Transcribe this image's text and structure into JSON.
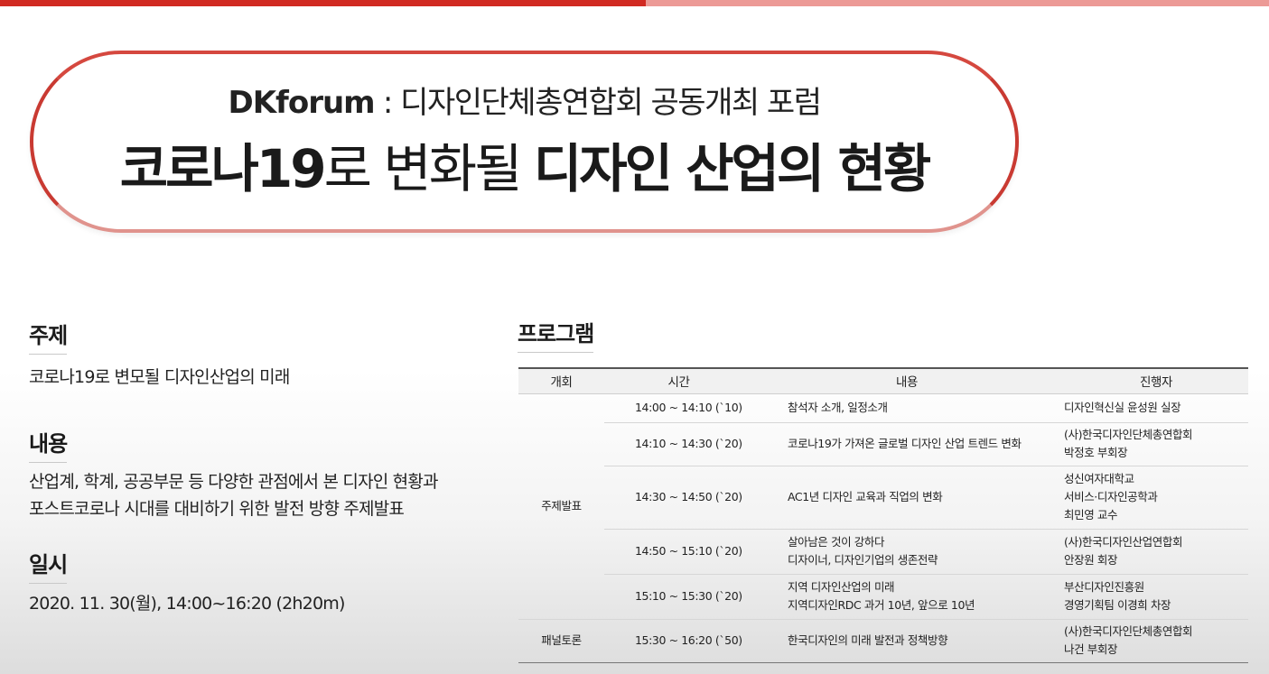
{
  "header": {
    "brand": "DKforum",
    "subtitle": " : 디자인단체총연합회 공동개최 포럼",
    "title_light_1": "코로나19",
    "title_light_2": "로 변화될 ",
    "title_bold": "디자인 산업의 현황"
  },
  "accent_colors": {
    "primary": "#d12a22",
    "light": "#ec9a96"
  },
  "topic": {
    "heading": "주제",
    "text": "코로나19로 변모될 디자인산업의 미래"
  },
  "content": {
    "heading": "내용",
    "line1": "산업계, 학계, 공공부문 등 다양한 관점에서 본 디자인 현황과",
    "line2": "포스트코로나 시대를 대비하기 위한 발전 방향 주제발표"
  },
  "datetime": {
    "heading": "일시",
    "text": "2020. 11. 30(월), 14:00~16:20 (2h20m)"
  },
  "program": {
    "heading": "프로그램",
    "columns": [
      "개회",
      "시간",
      "내용",
      "진행자"
    ],
    "group_main": "주제발표",
    "group_panel": "패널토론",
    "rows": [
      {
        "time": "14:00 ~ 14:10 (`10)",
        "content": [
          "참석자 소개, 일정소개"
        ],
        "host": [
          "디자인혁신실 윤성원 실장"
        ]
      },
      {
        "time": "14:10 ~ 14:30 (`20)",
        "content": [
          "코로나19가 가져온 글로벌 디자인 산업 트렌드 변화"
        ],
        "host": [
          "(사)한국디자인단체총연합회",
          "박정호 부회장"
        ]
      },
      {
        "time": "14:30 ~ 14:50 (`20)",
        "content": [
          "AC1년 디자인 교육과 직업의 변화"
        ],
        "host": [
          "성신여자대학교",
          "서비스·디자인공학과",
          "최민영 교수"
        ]
      },
      {
        "time": "14:50 ~ 15:10 (`20)",
        "content": [
          "살아남은 것이 강하다",
          "디자이너, 디자인기업의 생존전략"
        ],
        "host": [
          "(사)한국디자인산업연합회",
          "안장원 회장"
        ]
      },
      {
        "time": "15:10 ~ 15:30 (`20)",
        "content": [
          "지역 디자인산업의 미래",
          "지역디자인RDC 과거 10년, 앞으로 10년"
        ],
        "host": [
          "부산디자인진흥원",
          "경영기획팀 이경희 차장"
        ]
      },
      {
        "time": "15:30 ~ 16:20 (`50)",
        "content": [
          "한국디자인의 미래 발전과 정책방향"
        ],
        "host": [
          "(사)한국디자인단체총연합회",
          "나건 부회장"
        ]
      }
    ]
  }
}
